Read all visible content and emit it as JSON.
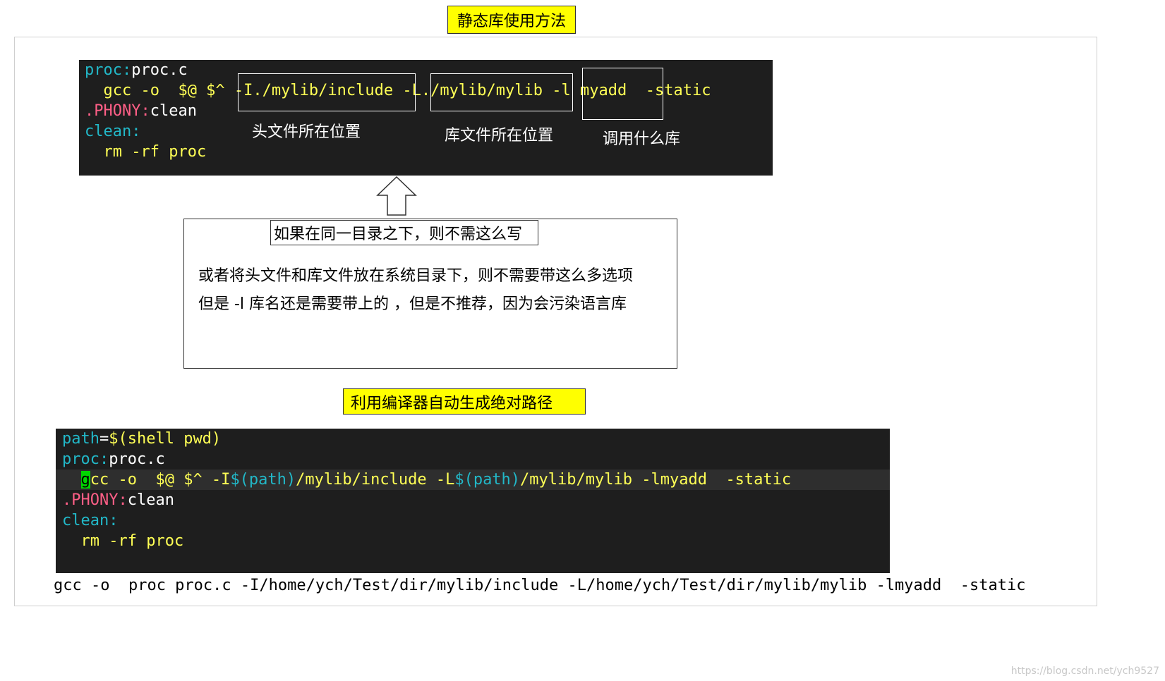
{
  "title_top": "静态库使用方法",
  "terminal1": {
    "lines": [
      {
        "a": "proc:",
        "b": "proc.c"
      },
      {
        "a": "  gcc -o  $@ $^ ",
        "b": "-I./mylib/include",
        "c": " -L./mylib/mylib",
        "d": " -l myadd",
        "e": "  -static"
      },
      {
        "a": ".PHONY:",
        "b": "clean"
      },
      {
        "a": "clean:"
      },
      {
        "a": "  rm -rf proc"
      }
    ],
    "note_include": "头文件所在位置",
    "note_lib": "库文件所在位置",
    "note_name": "调用什么库"
  },
  "textbox": {
    "title": "如果在同一目录之下，则不需这么写",
    "line1": "或者将头文件和库文件放在系统目录下，则不需要带这么多选项",
    "line2": "但是 -l 库名还是需要带上的 ，但是不推荐，因为会污染语言库"
  },
  "title_mid": "利用编译器自动生成绝对路径",
  "terminal2": {
    "l1a": "path",
    "l1b": "=",
    "l1c": "$(shell pwd)",
    "l2a": "proc:",
    "l2b": "proc.c",
    "l3cursor": "g",
    "l3a": "cc -o  $@ $^ -I",
    "l3b": "$(path)",
    "l3c": "/mylib/include -L",
    "l3d": "$(path)",
    "l3e": "/mylib/mylib -lmyadd  -static",
    "l4a": ".PHONY:",
    "l4b": "clean",
    "l5a": "clean:",
    "l6a": "  rm -rf proc"
  },
  "bottom_command": "gcc -o  proc proc.c -I/home/ych/Test/dir/mylib/include -L/home/ych/Test/dir/mylib/mylib -lmyadd  -static",
  "watermark": "https://blog.csdn.net/ych9527"
}
